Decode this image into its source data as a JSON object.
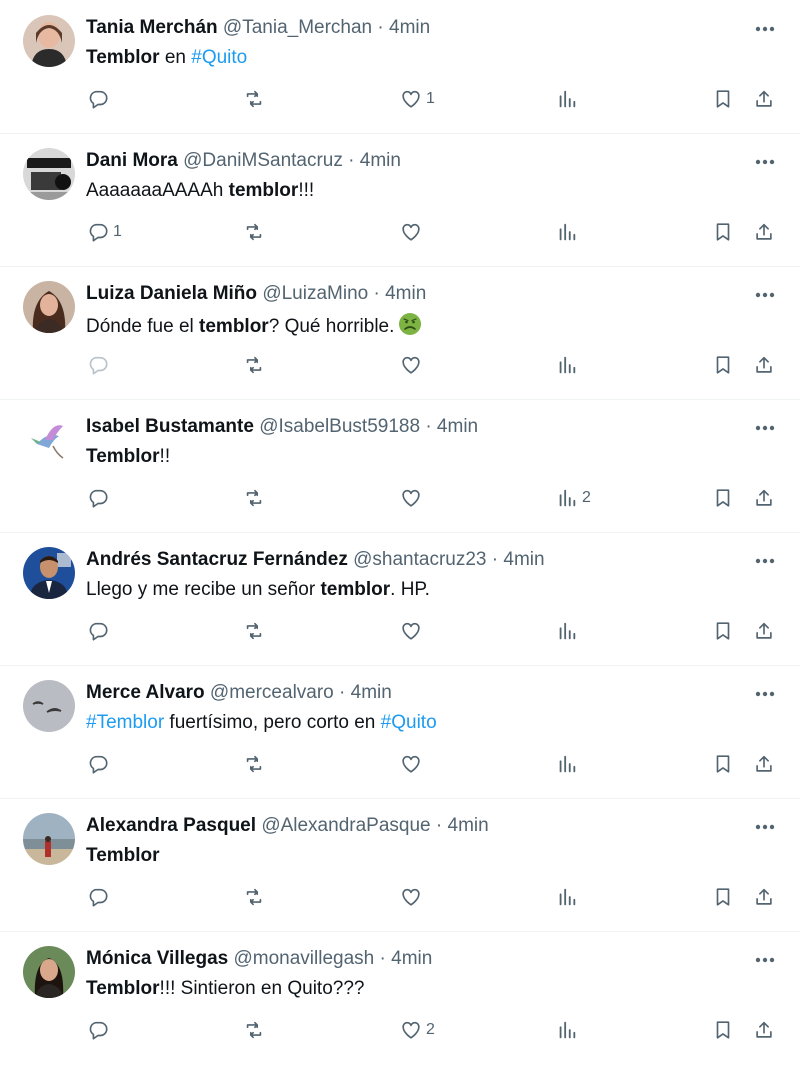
{
  "colors": {
    "link": "#1d9bf0",
    "text": "#0f1419",
    "muted": "#536471",
    "divider": "#eff3f4"
  },
  "tweets": [
    {
      "name": "Tania Merchán",
      "handle": "@Tania_Merchan",
      "separator": "·",
      "time": "4min",
      "avatar_icon": "portrait-avatar",
      "segments": [
        {
          "t": "Temblor",
          "s": "b"
        },
        {
          "t": " en ",
          "s": "n"
        },
        {
          "t": "#Quito",
          "s": "l"
        }
      ],
      "replies": "",
      "reposts": "",
      "likes": "1",
      "views": ""
    },
    {
      "name": "Dani Mora",
      "handle": "@DaniMSantacruz",
      "separator": "·",
      "time": "4min",
      "avatar_icon": "car-interior-avatar",
      "segments": [
        {
          "t": "AaaaaaaAAAAh ",
          "s": "n"
        },
        {
          "t": "temblor",
          "s": "b"
        },
        {
          "t": "!!!",
          "s": "n"
        }
      ],
      "replies": "1",
      "reposts": "",
      "likes": "",
      "views": ""
    },
    {
      "name": "Luiza Daniela Miño",
      "handle": "@LuizaMino",
      "separator": "·",
      "time": "4min",
      "avatar_icon": "portrait-avatar",
      "segments": [
        {
          "t": "Dónde fue el ",
          "s": "n"
        },
        {
          "t": "temblor",
          "s": "b"
        },
        {
          "t": "? Qué horrible.",
          "s": "n"
        }
      ],
      "emoji": "nauseated-face-emoji",
      "replies": "",
      "reposts": "",
      "likes": "",
      "views": ""
    },
    {
      "name": "Isabel Bustamante",
      "handle": "@IsabelBust59188",
      "separator": "·",
      "time": "4min",
      "avatar_icon": "hummingbird-avatar",
      "segments": [
        {
          "t": "Temblor",
          "s": "b"
        },
        {
          "t": "!!",
          "s": "n"
        }
      ],
      "replies": "",
      "reposts": "",
      "likes": "",
      "views": "2"
    },
    {
      "name": "Andrés Santacruz Fernández",
      "handle": "@shantacruz23",
      "separator": "·",
      "time": "4min",
      "avatar_icon": "portrait-suit-avatar",
      "segments": [
        {
          "t": "Llego y me recibe un señor ",
          "s": "n"
        },
        {
          "t": "temblor",
          "s": "b"
        },
        {
          "t": ". HP.",
          "s": "n"
        }
      ],
      "replies": "",
      "reposts": "",
      "likes": "",
      "views": ""
    },
    {
      "name": "Merce Alvaro",
      "handle": "@mercealvaro",
      "separator": "·",
      "time": "4min",
      "avatar_icon": "birds-avatar",
      "segments": [
        {
          "t": "#Temblor",
          "s": "l"
        },
        {
          "t": " fuertísimo, pero corto en ",
          "s": "n"
        },
        {
          "t": "#Quito",
          "s": "l"
        }
      ],
      "replies": "",
      "reposts": "",
      "likes": "",
      "views": ""
    },
    {
      "name": "Alexandra Pasquel",
      "handle": "@AlexandraPasque",
      "separator": "·",
      "time": "4min",
      "avatar_icon": "beach-avatar",
      "segments": [
        {
          "t": "Temblor",
          "s": "b"
        }
      ],
      "replies": "",
      "reposts": "",
      "likes": "",
      "views": ""
    },
    {
      "name": "Mónica Villegas",
      "handle": "@monavillegash",
      "separator": "·",
      "time": "4min",
      "avatar_icon": "portrait-avatar",
      "segments": [
        {
          "t": "Temblor",
          "s": "b"
        },
        {
          "t": "!!! Sintieron en Quito???",
          "s": "n"
        }
      ],
      "replies": "",
      "reposts": "",
      "likes": "2",
      "views": ""
    }
  ]
}
